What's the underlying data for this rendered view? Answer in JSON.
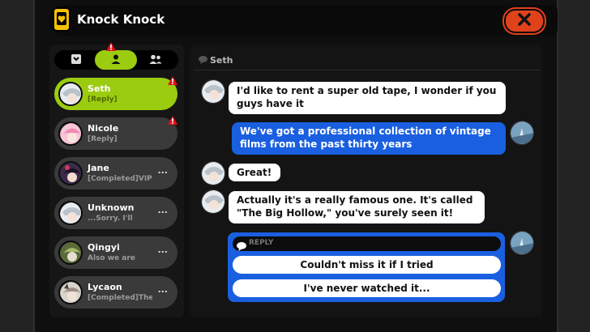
{
  "window": {
    "title": "Knock Knock",
    "title_icon": "phone-heart-icon",
    "close_icon": "close-x-icon"
  },
  "colors": {
    "accent": "#9ccc10",
    "close": "#e0421c",
    "reply_blue": "#1a5fe0",
    "alert": "#e0121c"
  },
  "tabs": [
    {
      "icon": "contacts-book-icon",
      "active": false
    },
    {
      "icon": "person-icon",
      "active": true,
      "alert": "!"
    },
    {
      "icon": "group-icon",
      "active": false
    }
  ],
  "contacts": [
    {
      "name": "Seth",
      "preview": "[Reply]",
      "active": true,
      "alert": "!"
    },
    {
      "name": "Nicole",
      "preview": "[Reply]",
      "active": false,
      "alert": "!"
    },
    {
      "name": "Jane",
      "preview": "[Completed]VIP",
      "active": false,
      "more": "..."
    },
    {
      "name": "Unknown",
      "preview": "...Sorry. I'll",
      "active": false,
      "more": "..."
    },
    {
      "name": "Qingyi",
      "preview": "Also  we are",
      "active": false,
      "more": "..."
    },
    {
      "name": "Lycaon",
      "preview": "[Completed]The",
      "active": false,
      "more": "..."
    }
  ],
  "chat": {
    "header": "Seth",
    "header_icon": "speech-bubble-icon",
    "messages": [
      {
        "side": "in",
        "text_1": "I'd like to rent a super old tape, I wonder if you",
        "text_2": "guys have it"
      },
      {
        "side": "out",
        "text_1": "We've got a professional collection of vintage",
        "text_2": "films from the past thirty years"
      },
      {
        "side": "in",
        "text_1": "Great!"
      },
      {
        "side": "in",
        "text_1": "Actually it's a really famous one. It's called",
        "text_2": "\"The Big Hollow,\" you've surely seen it!"
      }
    ],
    "reply": {
      "label": "REPLY",
      "options": [
        "Couldn't miss it if I tried",
        "I've never watched it..."
      ]
    }
  }
}
